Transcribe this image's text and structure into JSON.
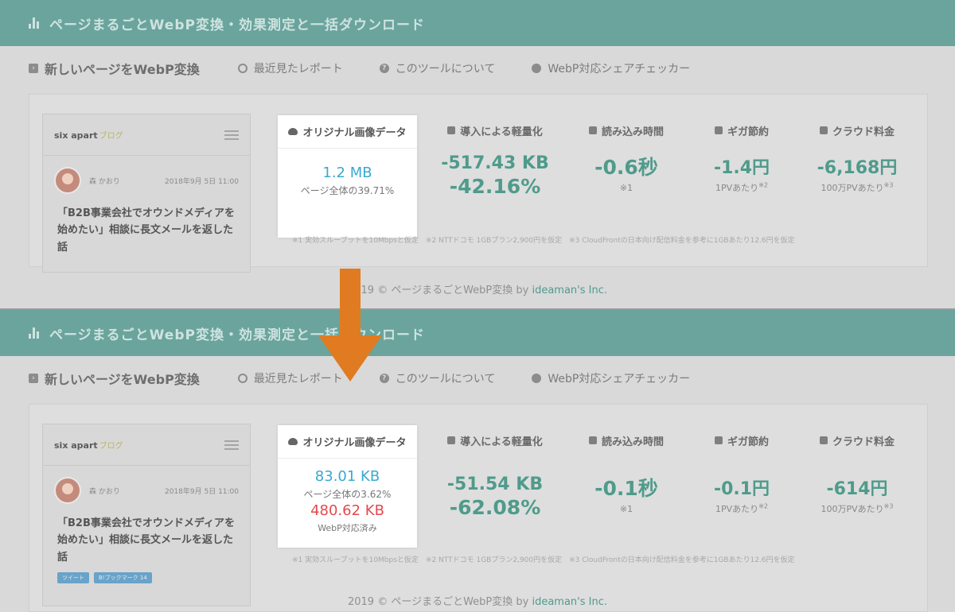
{
  "app": {
    "title": "ページまるごとWebP変換・効果測定と一括ダウンロード"
  },
  "nav": {
    "new_page": "新しいページをWebP変換",
    "recent": "最近見たレポート",
    "about": "このツールについて",
    "checker": "WebP対応シェアチェッカー"
  },
  "preview": {
    "logo": "six apart",
    "logo_sub": "ブログ",
    "author": "森 かおり",
    "date": "2018年9月 5日 11:00",
    "post_title": "「B2B事業会社でオウンドメディアを始めたい」相談に長文メールを返した話",
    "tweet": "ツイート",
    "bookmark": "B!ブックマーク 14"
  },
  "headers": {
    "original": "オリジナル画像データ",
    "reduction": "導入による軽量化",
    "load_time": "読み込み時間",
    "giga": "ギガ節約",
    "cloud": "クラウド料金"
  },
  "before": {
    "original_size": "1.2 MB",
    "original_share": "ページ全体の39.71%",
    "reduction_kb": "-517.43 KB",
    "reduction_pct": "-42.16%",
    "load_time": "-0.6秒",
    "load_note": "※1",
    "giga": "-1.4円",
    "giga_note": "1PVあたり",
    "giga_note_sup": "※2",
    "cloud": "-6,168円",
    "cloud_note": "100万PVあたり",
    "cloud_note_sup": "※3"
  },
  "after": {
    "original_size": "83.01 KB",
    "original_share": "ページ全体の3.62%",
    "webp_size": "480.62 KB",
    "webp_label": "WebP対応済み",
    "reduction_kb": "-51.54 KB",
    "reduction_pct": "-62.08%",
    "load_time": "-0.1秒",
    "load_note": "※1",
    "giga": "-0.1円",
    "giga_note": "1PVあたり",
    "giga_note_sup": "※2",
    "cloud": "-614円",
    "cloud_note": "100万PVあたり",
    "cloud_note_sup": "※3"
  },
  "notes": "※1 実効スループットを10Mbpsと仮定　※2 NTTドコモ 1GBプラン2,900円を仮定　※3 CloudFrontの日本向け配信料金を参考に1GBあたり12.6円を仮定",
  "footer": {
    "text": "2019 © ページまるごとWebP変換 by ",
    "link": "ideaman's Inc."
  },
  "colors": {
    "titlebar": "#6aa49d",
    "accent_green": "#4f9b8b",
    "accent_blue": "#39a9cf",
    "accent_red": "#e5484d",
    "arrow": "#e07b22"
  }
}
